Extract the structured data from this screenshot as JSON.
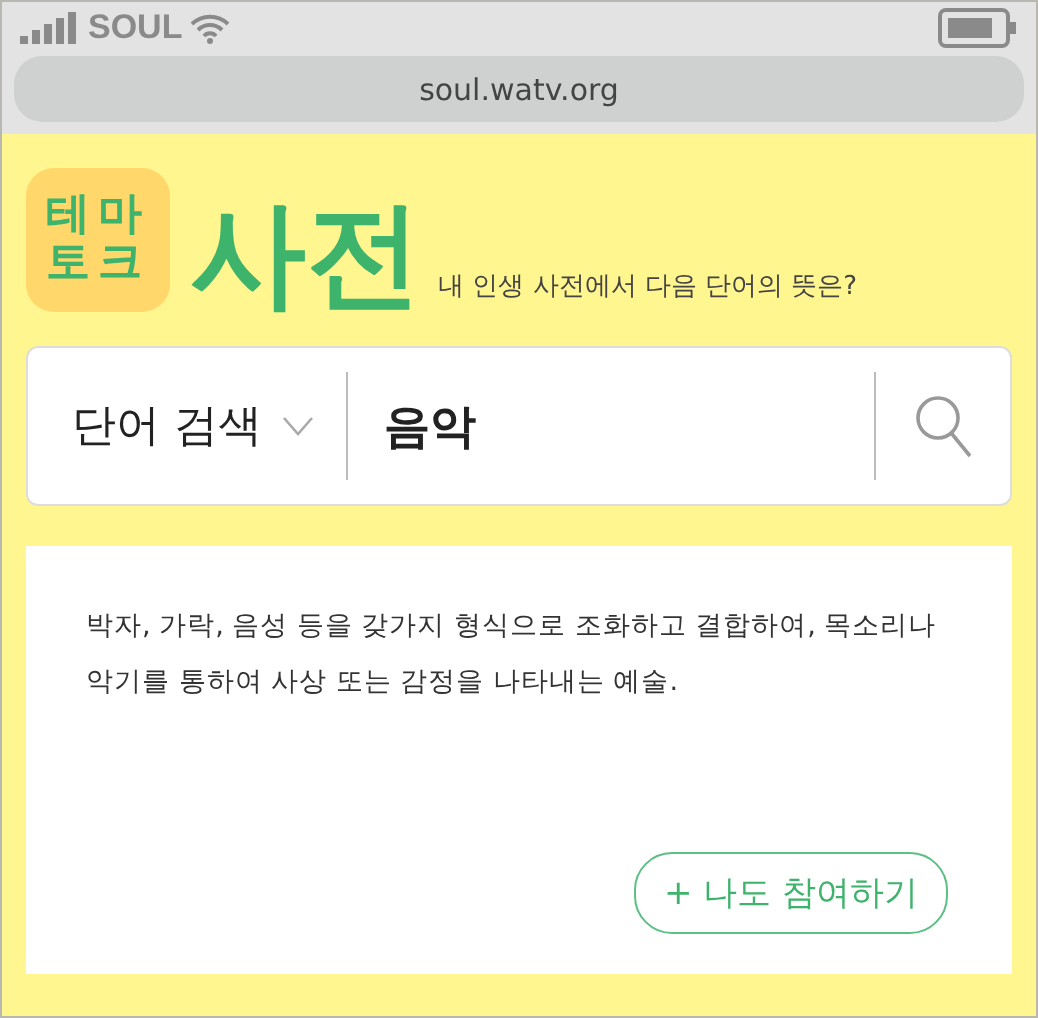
{
  "status_bar": {
    "carrier": "SOUL"
  },
  "address_bar": {
    "url": "soul.watv.org"
  },
  "header": {
    "logo_lines": [
      "테마",
      "토크"
    ],
    "title": "사전",
    "subtitle": "내 인생 사전에서 다음 단어의 뜻은?"
  },
  "search": {
    "mode": "단어 검색",
    "value": "음악"
  },
  "definition": {
    "text": "박자, 가락, 음성 등을 갖가지 형식으로 조화하고 결합하여, 목소리나 악기를 통하여 사상 또는 감정을 나타내는 예술.",
    "button": "+ 나도 참여하기"
  }
}
